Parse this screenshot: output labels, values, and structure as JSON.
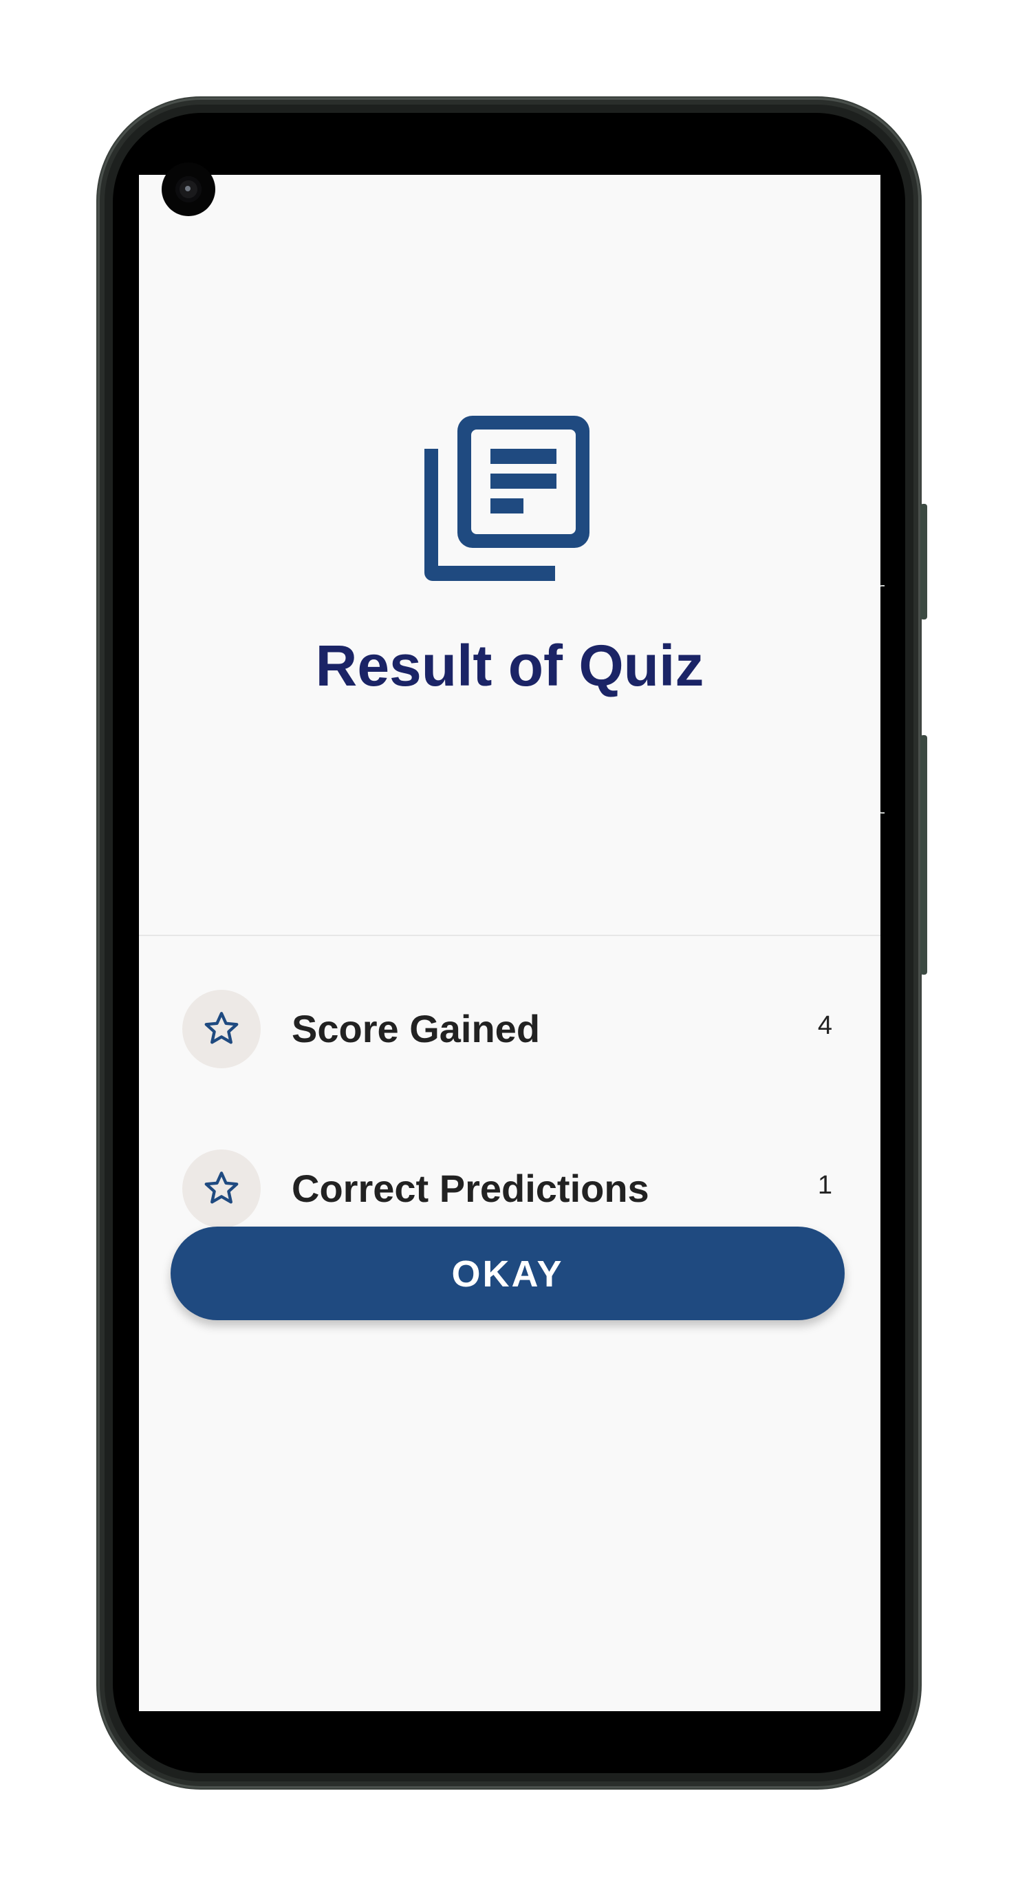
{
  "screen": {
    "title": "Result of Quiz",
    "hero_icon": "article-stack-icon",
    "results": [
      {
        "icon": "star-icon",
        "label": "Score Gained",
        "value": "4"
      },
      {
        "icon": "star-icon",
        "label": "Correct Predictions",
        "value": "1"
      }
    ],
    "okay_label": "OKAY"
  },
  "colors": {
    "primary": "#1f4a80",
    "title": "#1b2466",
    "background": "#f9f9f9",
    "icon_circle": "#ede9e6"
  }
}
